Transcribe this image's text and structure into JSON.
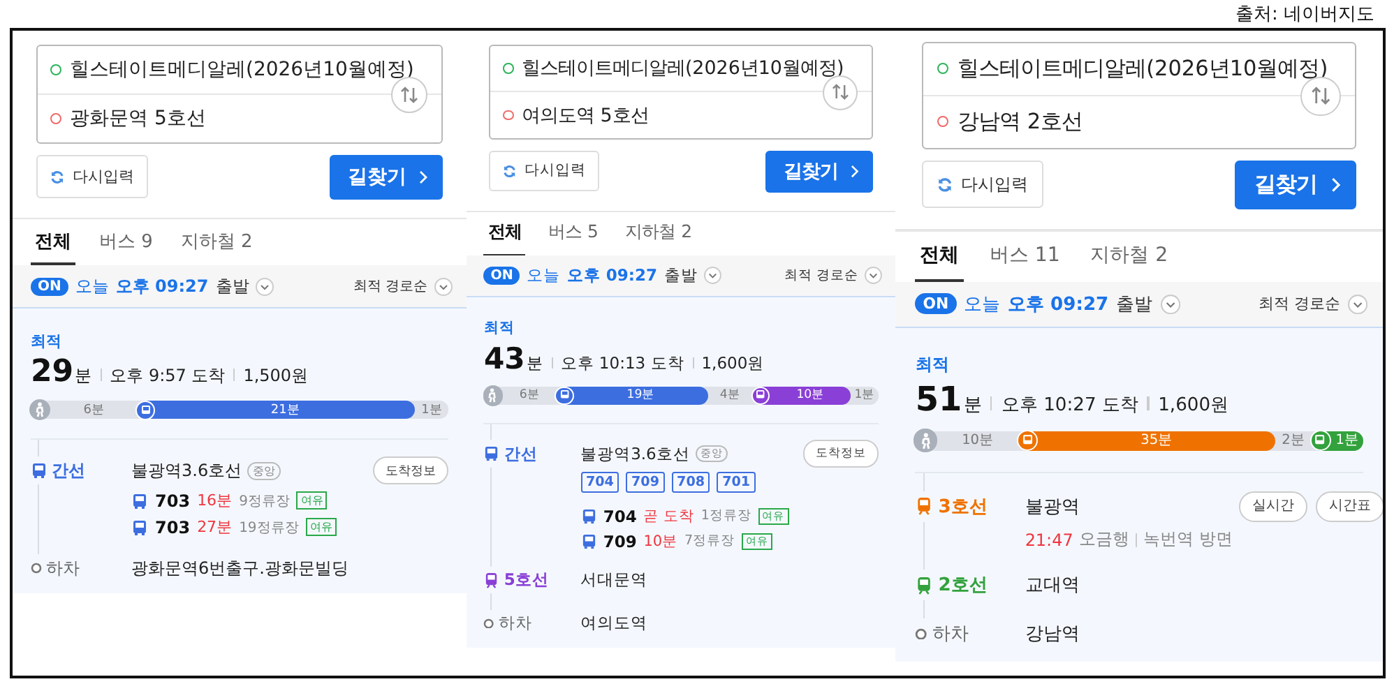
{
  "caption": "출처: 네이버지도",
  "panels": [
    {
      "origin": "힐스테이트메디알레(2026년10월예정)",
      "destination": "광화문역 5호선",
      "reset_button": "다시입력",
      "search_button": "길찾기",
      "tabs": [
        {
          "label": "전체",
          "selected": true
        },
        {
          "label": "버스 9",
          "selected": false
        },
        {
          "label": "지하철 2",
          "selected": false
        }
      ],
      "on_badge": "ON",
      "departure": {
        "day": "오늘",
        "time": "오후 09:27",
        "action": "출발"
      },
      "sort": "최적 경로순",
      "route": {
        "tag": "최적",
        "minutes": "29",
        "unit": "분",
        "arrival": "오후 9:57 도착",
        "fare": "1,500원",
        "segments": [
          {
            "kind": "walk",
            "label": "6분"
          },
          {
            "kind": "ride",
            "label": "21분",
            "color": "#3d6ee0"
          },
          {
            "kind": "gap",
            "label": "1분"
          }
        ],
        "steps": [
          {
            "kind": "bus",
            "line": "간선",
            "color": "#3d6ee0",
            "station": "불광역3.6호선",
            "station_tag": "중앙",
            "buttons": [
              "도착정보"
            ],
            "arrivals": [
              {
                "number": "703",
                "eta": "16분",
                "stops": "9정류장",
                "crowd": "여유"
              },
              {
                "number": "703",
                "eta": "27분",
                "stops": "19정류장",
                "crowd": "여유"
              }
            ]
          },
          {
            "kind": "alight",
            "line": "하차",
            "station": "광화문역6번출구.광화문빌딩"
          }
        ]
      }
    },
    {
      "origin": "힐스테이트메디알레(2026년10월예정)",
      "destination": "여의도역 5호선",
      "reset_button": "다시입력",
      "search_button": "길찾기",
      "tabs": [
        {
          "label": "전체",
          "selected": true
        },
        {
          "label": "버스 5",
          "selected": false
        },
        {
          "label": "지하철 2",
          "selected": false
        }
      ],
      "on_badge": "ON",
      "departure": {
        "day": "오늘",
        "time": "오후 09:27",
        "action": "출발"
      },
      "sort": "최적 경로순",
      "route": {
        "tag": "최적",
        "minutes": "43",
        "unit": "분",
        "arrival": "오후 10:13 도착",
        "fare": "1,600원",
        "segments": [
          {
            "kind": "walk",
            "label": "6분"
          },
          {
            "kind": "ride",
            "label": "19분",
            "color": "#3d6ee0"
          },
          {
            "kind": "gap",
            "label": "4분"
          },
          {
            "kind": "ride",
            "label": "10분",
            "color": "#8a3fd6"
          },
          {
            "kind": "gap",
            "label": "1분"
          }
        ],
        "steps": [
          {
            "kind": "bus",
            "line": "간선",
            "color": "#3d6ee0",
            "station": "불광역3.6호선",
            "station_tag": "중앙",
            "buttons": [
              "도착정보"
            ],
            "chips": [
              "704",
              "709",
              "708",
              "701"
            ],
            "arrivals": [
              {
                "number": "704",
                "eta": "곧 도착",
                "stops": "1정류장",
                "crowd": "여유"
              },
              {
                "number": "709",
                "eta": "10분",
                "stops": "7정류장",
                "crowd": "여유"
              }
            ]
          },
          {
            "kind": "subway",
            "line": "5호선",
            "color": "#8a3fd6",
            "station": "서대문역"
          },
          {
            "kind": "alight",
            "line": "하차",
            "station": "여의도역"
          }
        ]
      }
    },
    {
      "origin": "힐스테이트메디알레(2026년10월예정)",
      "destination": "강남역 2호선",
      "reset_button": "다시입력",
      "search_button": "길찾기",
      "tabs": [
        {
          "label": "전체",
          "selected": true
        },
        {
          "label": "버스 11",
          "selected": false
        },
        {
          "label": "지하철 2",
          "selected": false
        }
      ],
      "on_badge": "ON",
      "departure": {
        "day": "오늘",
        "time": "오후 09:27",
        "action": "출발"
      },
      "sort": "최적 경로순",
      "route": {
        "tag": "최적",
        "minutes": "51",
        "unit": "분",
        "arrival": "오후 10:27 도착",
        "fare": "1,600원",
        "segments": [
          {
            "kind": "walk",
            "label": "10분"
          },
          {
            "kind": "ride",
            "label": "35분",
            "color": "#ef7200"
          },
          {
            "kind": "gap",
            "label": "2분"
          },
          {
            "kind": "ride",
            "label": "1분",
            "color": "#33a23d"
          }
        ],
        "steps": [
          {
            "kind": "subway",
            "line": "3호선",
            "color": "#ef7200",
            "station": "불광역",
            "buttons": [
              "실시간",
              "시간표"
            ],
            "schedule": {
              "time": "21:47",
              "direction": "오금행",
              "toward": "녹번역 방면"
            }
          },
          {
            "kind": "subway",
            "line": "2호선",
            "color": "#33a23d",
            "station": "교대역"
          },
          {
            "kind": "alight",
            "line": "하차",
            "station": "강남역"
          }
        ]
      }
    }
  ]
}
